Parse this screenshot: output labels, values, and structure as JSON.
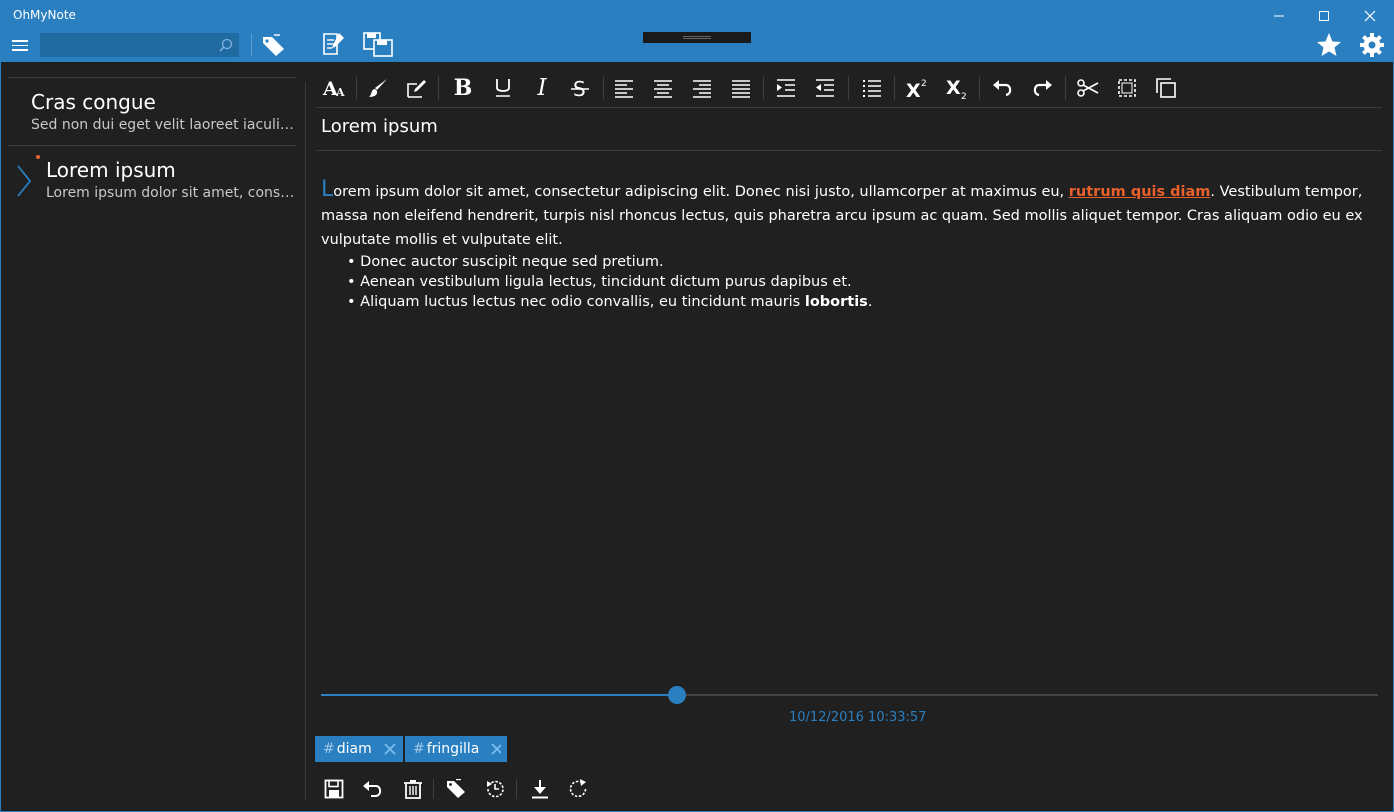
{
  "app": {
    "title": "OhMyNote"
  },
  "search": {
    "placeholder": "",
    "value": ""
  },
  "notes": [
    {
      "title": "Cras congue",
      "preview": "Sed non dui eget velit laoreet iaculis. Cras"
    },
    {
      "title": "Lorem ipsum",
      "preview": "Lorem ipsum dolor sit amet, consectetur"
    }
  ],
  "editor": {
    "title": "Lorem ipsum",
    "dropcap": "L",
    "para_a": "orem ipsum dolor sit amet, consectetur adipiscing elit. Donec nisi justo, ullamcorper at maximus eu, ",
    "link": "rutrum quis diam",
    "para_b": ". Vestibulum tempor, massa non eleifend hendrerit, turpis nisl rhoncus lectus, quis pharetra arcu ipsum ac quam. Sed mollis aliquet tempor. Cras aliquam odio eu ex vulputate mollis et vulputate elit.",
    "bullets": [
      "Donec auctor suscipit neque sed pretium.",
      "Aenean vestibulum ligula lectus, tincidunt dictum purus dapibus et.",
      "Aliquam luctus lectus nec odio convallis, eu tincidunt mauris "
    ],
    "bullet_bold": "lobortis",
    "bullet_end": "."
  },
  "history": {
    "position_fraction": 0.337,
    "timestamp": "10/12/2016 10:33:57"
  },
  "tags": [
    {
      "hash": "#",
      "name": "diam"
    },
    {
      "hash": "#",
      "name": "fringilla"
    }
  ],
  "colors": {
    "accent": "#2a7fc0",
    "link": "#e8602c",
    "background": "#202020"
  }
}
